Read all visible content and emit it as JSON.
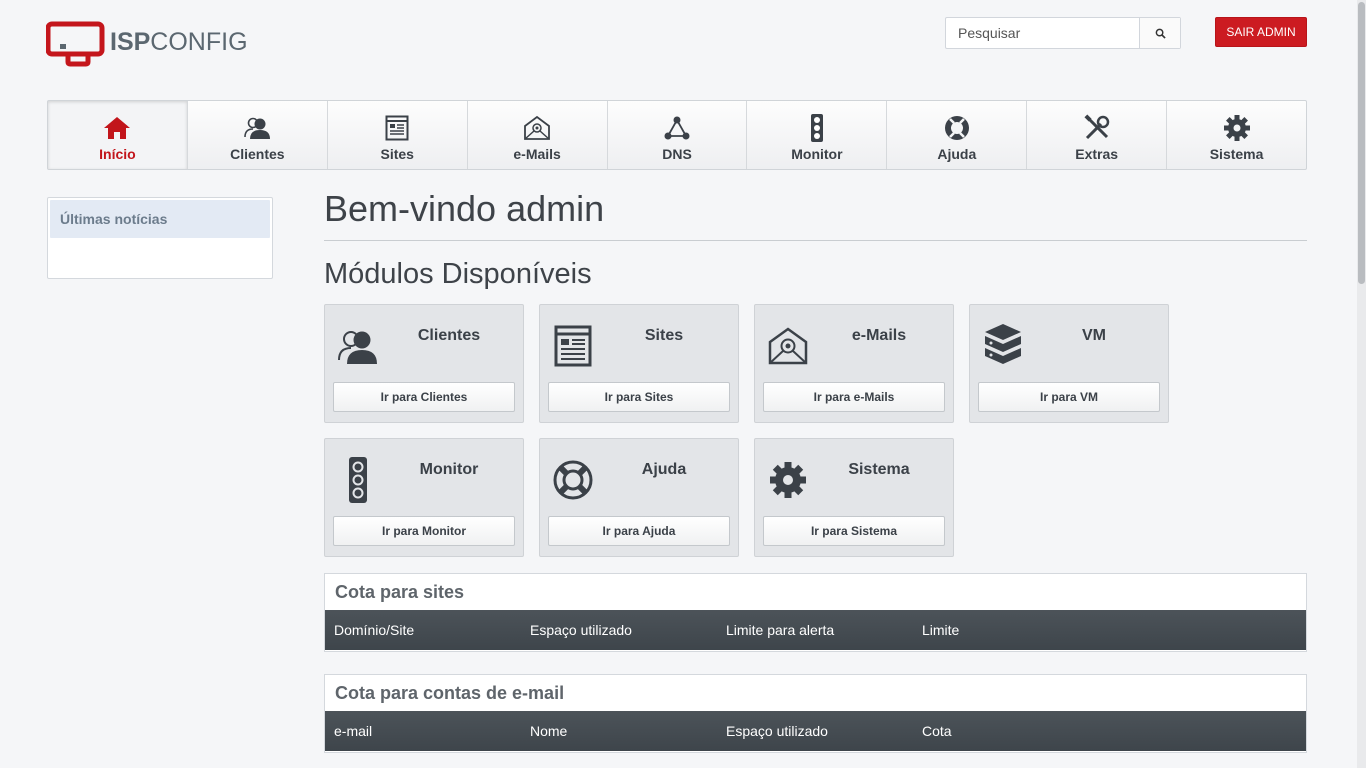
{
  "header": {
    "logo_text_bold": "ISP",
    "logo_text_light": "CONFIG",
    "search_placeholder": "Pesquisar",
    "logout_label": "SAIR ADMIN"
  },
  "nav": {
    "items": [
      {
        "label": "Início",
        "icon": "home-icon",
        "active": true
      },
      {
        "label": "Clientes",
        "icon": "users-icon"
      },
      {
        "label": "Sites",
        "icon": "sites-icon"
      },
      {
        "label": "e-Mails",
        "icon": "mail-icon"
      },
      {
        "label": "DNS",
        "icon": "dns-icon"
      },
      {
        "label": "Monitor",
        "icon": "traffic-light-icon"
      },
      {
        "label": "Ajuda",
        "icon": "lifebuoy-icon"
      },
      {
        "label": "Extras",
        "icon": "tools-icon"
      },
      {
        "label": "Sistema",
        "icon": "gear-icon"
      }
    ]
  },
  "sidebar": {
    "news_title": "Últimas notícias"
  },
  "main": {
    "title": "Bem-vindo admin",
    "modules_title": "Módulos Disponíveis",
    "modules": [
      {
        "title": "Clientes",
        "button": "Ir para Clientes",
        "icon": "users-icon"
      },
      {
        "title": "Sites",
        "button": "Ir para Sites",
        "icon": "sites-icon"
      },
      {
        "title": "e-Mails",
        "button": "Ir para e-Mails",
        "icon": "mail-icon"
      },
      {
        "title": "VM",
        "button": "Ir para VM",
        "icon": "server-stack-icon"
      },
      {
        "title": "Monitor",
        "button": "Ir para Monitor",
        "icon": "traffic-light-icon"
      },
      {
        "title": "Ajuda",
        "button": "Ir para Ajuda",
        "icon": "lifebuoy-icon"
      },
      {
        "title": "Sistema",
        "button": "Ir para Sistema",
        "icon": "gear-icon"
      }
    ],
    "site_quota": {
      "title": "Cota para sites",
      "columns": [
        "Domínio/Site",
        "Espaço utilizado",
        "Limite para alerta",
        "Limite"
      ]
    },
    "mail_quota": {
      "title": "Cota para contas de e-mail",
      "columns": [
        "e-mail",
        "Nome",
        "Espaço utilizado",
        "Cota"
      ]
    }
  },
  "colors": {
    "accent_red": "#cc1b21",
    "table_header": "#434a50"
  }
}
